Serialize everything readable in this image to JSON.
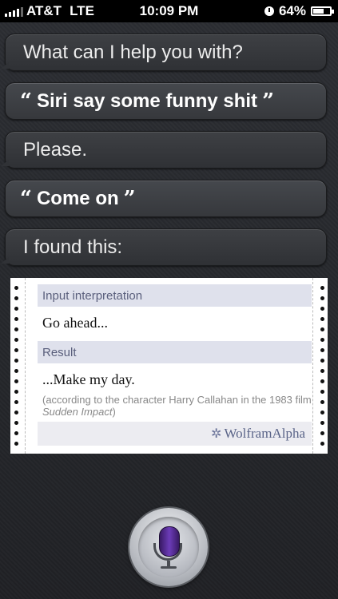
{
  "status_bar": {
    "carrier": "AT&T",
    "network": "LTE",
    "time": "10:09 PM",
    "battery": "64%",
    "battery_level": 0.64
  },
  "conversation": {
    "siri_prompt": "What can I help you with?",
    "user_request_1": "Siri say some funny shit",
    "siri_reply_1": "Please.",
    "user_request_2": "Come on",
    "siri_reply_2": "I found this:"
  },
  "wolfram": {
    "input_header": "Input interpretation",
    "input_value": "Go ahead...",
    "result_header": "Result",
    "result_value": "...Make my day.",
    "note_prefix": "(according to the character Harry Callahan in the 1983 film ",
    "note_film": "Sudden Impact",
    "note_suffix": ")",
    "logo_text": "WolframAlpha"
  },
  "icons": {
    "signal": "signal-bars-icon",
    "alarm": "clock-icon",
    "battery": "battery-icon",
    "mic": "microphone-icon",
    "wolfram_star": "wolfram-star-icon"
  }
}
